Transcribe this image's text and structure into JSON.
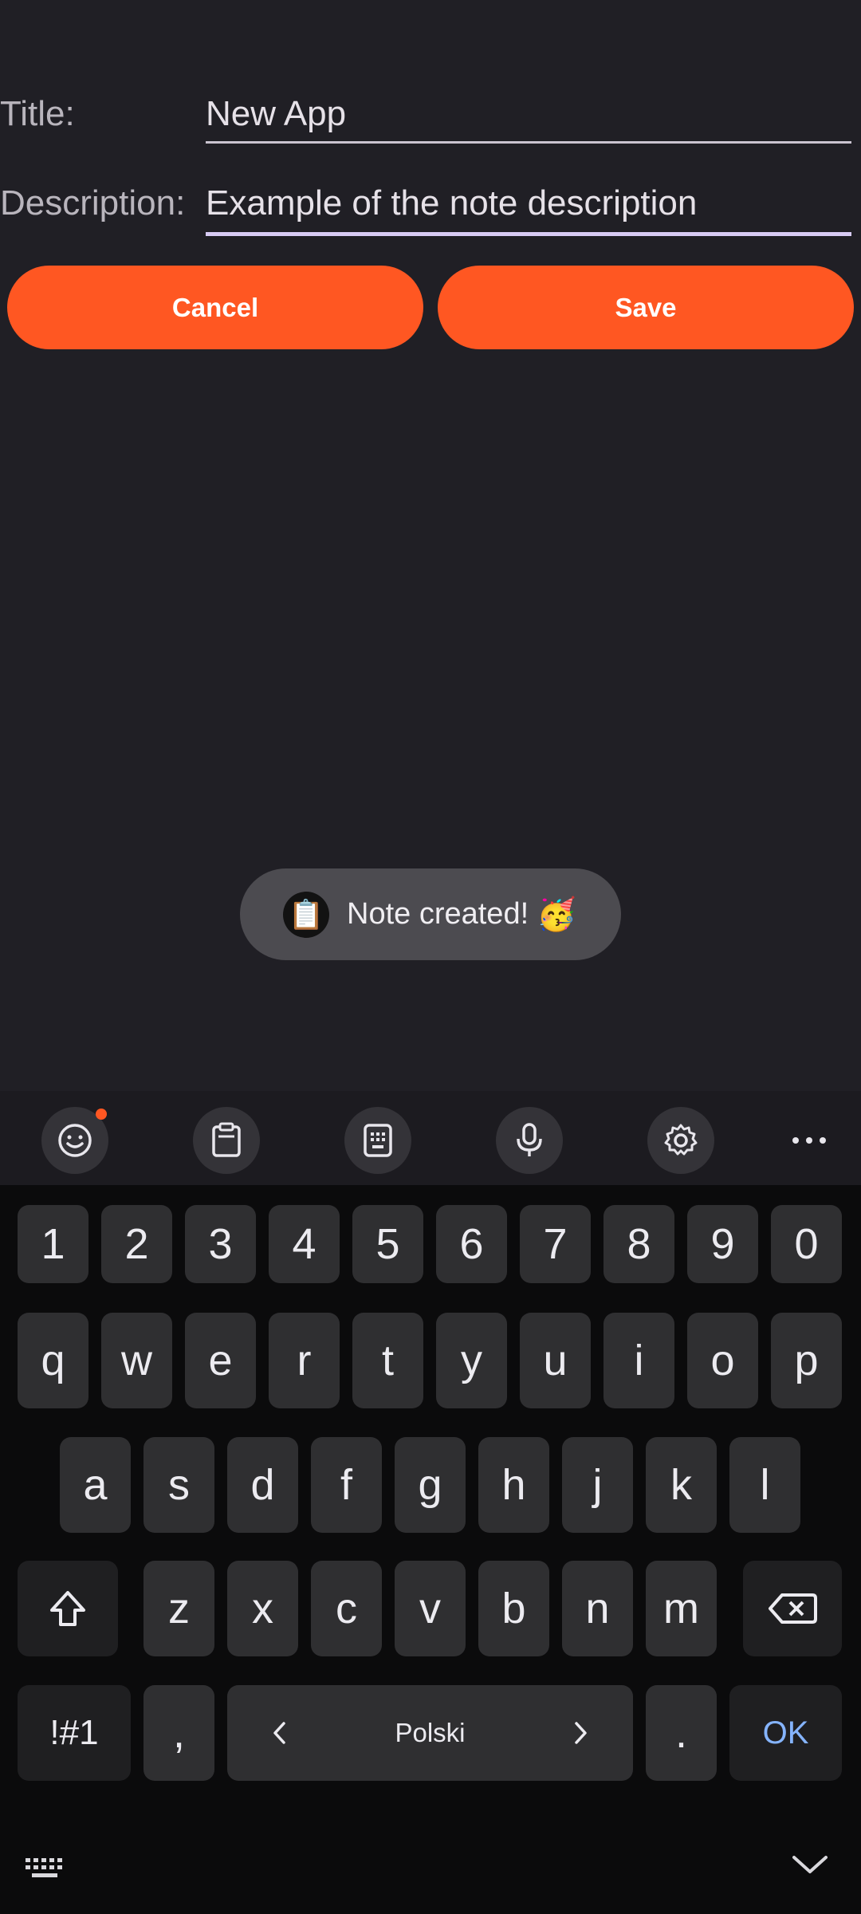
{
  "form": {
    "title_label": "Title:",
    "title_value": "New App",
    "description_label": "Description:",
    "description_value": "Example of the note description"
  },
  "buttons": {
    "cancel": "Cancel",
    "save": "Save"
  },
  "toast": {
    "app_icon": "📋",
    "text": "Note created!",
    "emoji": "🥳"
  },
  "keyboard": {
    "toolbar_icons": [
      "emoji-icon",
      "clipboard-icon",
      "keypad-icon",
      "microphone-icon",
      "settings-icon",
      "more-icon"
    ],
    "number_row": [
      "1",
      "2",
      "3",
      "4",
      "5",
      "6",
      "7",
      "8",
      "9",
      "0"
    ],
    "row1": [
      "q",
      "w",
      "e",
      "r",
      "t",
      "y",
      "u",
      "i",
      "o",
      "p"
    ],
    "row2": [
      "a",
      "s",
      "d",
      "f",
      "g",
      "h",
      "j",
      "k",
      "l"
    ],
    "row3": [
      "z",
      "x",
      "c",
      "v",
      "b",
      "n",
      "m"
    ],
    "symbols_key": "!#1",
    "comma_key": ",",
    "space_label": "Polski",
    "period_key": ".",
    "enter_key": "OK"
  },
  "colors": {
    "accent": "#ff5722",
    "background": "#201f25",
    "ok_text": "#85b4ff"
  }
}
